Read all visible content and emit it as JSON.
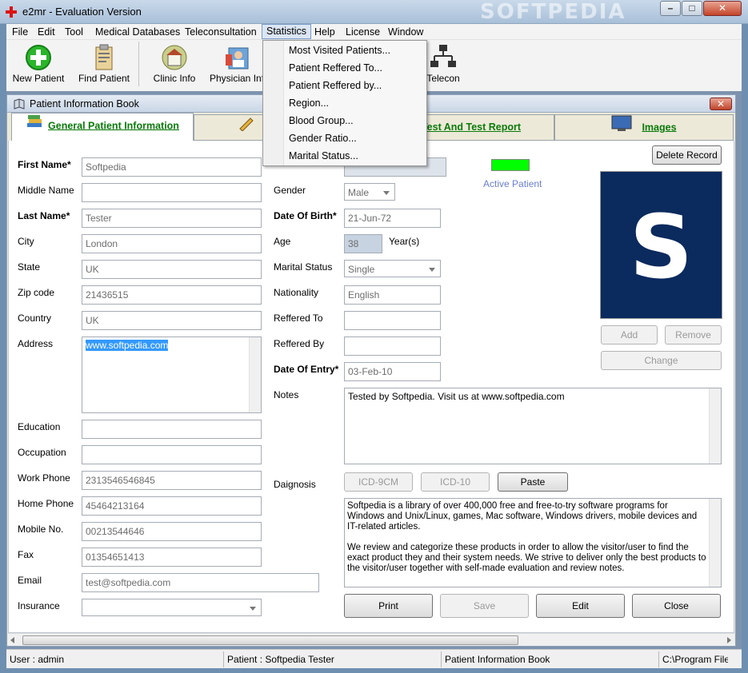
{
  "window": {
    "title": "e2mr - Evaluation Version",
    "watermark": "SOFTPEDIA",
    "min": "–",
    "max": "□",
    "close": "✕"
  },
  "menu": [
    "File",
    "Edit",
    "Tool",
    "Medical Databases",
    "Teleconsultation",
    "Statistics",
    "Help",
    "License",
    "Window"
  ],
  "statistics_menu": [
    "Most Visited Patients...",
    "Patient Reffered To...",
    "Patient Reffered by...",
    "Region...",
    "Blood Group...",
    "Gender Ratio...",
    "Marital Status..."
  ],
  "toolbar": {
    "new_patient": "New Patient",
    "find_patient": "Find Patient",
    "clinic_info": "Clinic Info",
    "physician_info": "Physician Info",
    "telecon": "Telecon"
  },
  "child": {
    "title": "Patient Information Book",
    "close": "✕"
  },
  "tabs": {
    "general": "General Patient Information",
    "test": "Test And Test Report",
    "images": "Images"
  },
  "form": {
    "first_name_label": "First Name*",
    "first_name": "Softpedia",
    "middle_name_label": "Middle Name",
    "middle_name": "",
    "last_name_label": "Last Name*",
    "last_name": "Tester",
    "city_label": "City",
    "city": "London",
    "state_label": "State",
    "state": "UK",
    "zip_label": "Zip code",
    "zip": "21436515",
    "country_label": "Country",
    "country": "UK",
    "address_label": "Address",
    "address": "www.softpedia.com",
    "education_label": "Education",
    "education": "",
    "occupation_label": "Occupation",
    "occupation": "",
    "work_phone_label": "Work Phone",
    "work_phone": "2313546546845",
    "home_phone_label": "Home Phone",
    "home_phone": "45464213164",
    "mobile_label": "Mobile No.",
    "mobile": "00213544646",
    "fax_label": "Fax",
    "fax": "01354651413",
    "email_label": "Email",
    "email": "test@softpedia.com",
    "insurance_label": "Insurance",
    "insurance": "",
    "gender_label": "Gender",
    "gender": "Male",
    "dob_label": "Date Of Birth*",
    "dob": "21-Jun-72",
    "age_label": "Age",
    "age": "38",
    "age_unit": "Year(s)",
    "marital_label": "Marital Status",
    "marital": "Single",
    "nationality_label": "Nationality",
    "nationality": "English",
    "referred_to_label": "Reffered To",
    "referred_to": "",
    "referred_by_label": "Reffered By",
    "referred_by": "",
    "entry_label": "Date Of Entry*",
    "entry": "03-Feb-10",
    "notes_label": "Notes",
    "notes": "Tested by Softpedia. Visit us at www.softpedia.com",
    "diagnosis_label": "Daignosis",
    "diagnosis_text_1": "Softpedia is a library of over 400,000 free and free-to-try software programs for Windows and Unix/Linux, games, Mac software, Windows drivers, mobile devices and IT-related articles.",
    "diagnosis_text_2": "We review and categorize these products in order to allow the visitor/user to find the exact product they and their system needs. We strive to deliver only the best products to the visitor/user together with self-made evaluation and review notes.",
    "active_patient": "Active Patient",
    "active_color": "#00ff00"
  },
  "buttons": {
    "delete_record": "Delete Record",
    "add": "Add",
    "remove": "Remove",
    "change": "Change",
    "icd9": "ICD-9CM",
    "icd10": "ICD-10",
    "paste": "Paste",
    "print": "Print",
    "save": "Save",
    "edit": "Edit",
    "close": "Close"
  },
  "photo": {
    "letter": "S",
    "bg": "#0b2a5e"
  },
  "status": {
    "user": "User : admin",
    "patient": "Patient : Softpedia  Tester",
    "module": "Patient Information Book",
    "path": "C:\\Program Files\\e"
  }
}
